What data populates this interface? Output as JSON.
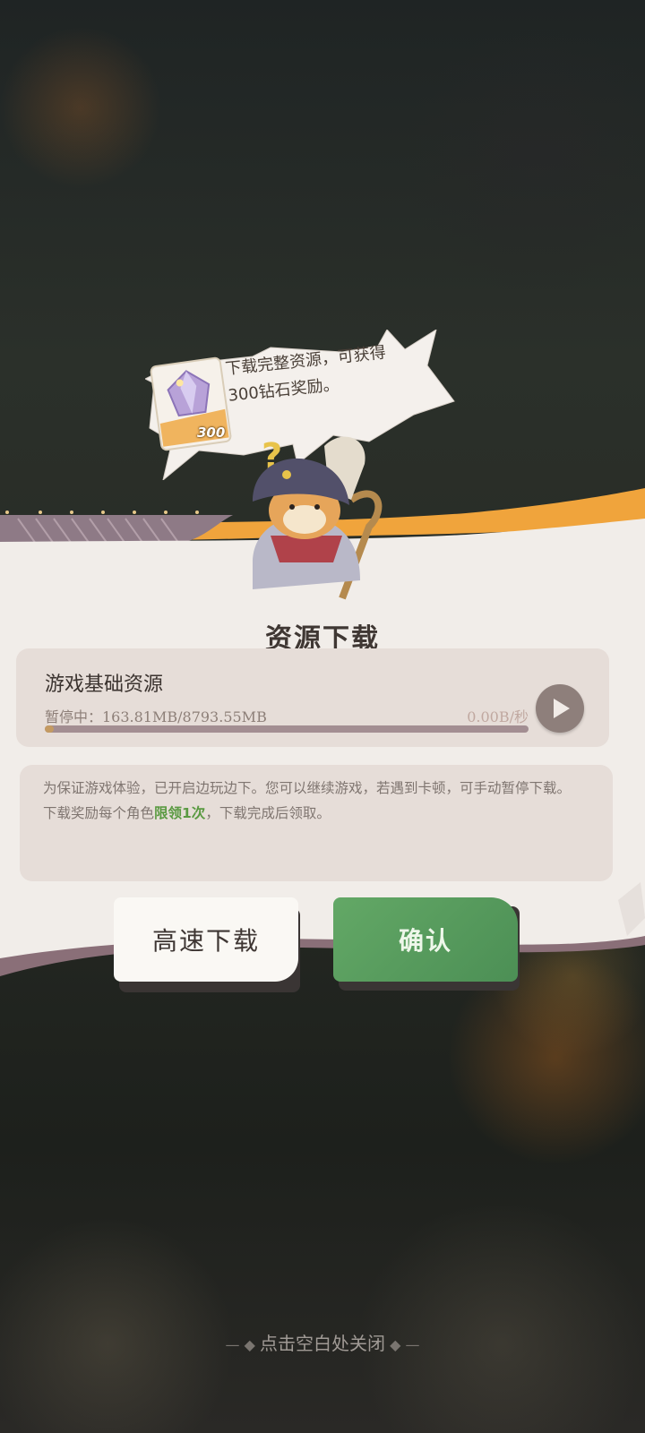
{
  "reward_bubble": {
    "text_line1": "下载完整资源，可获得",
    "text_line2": "300钻石奖励。",
    "diamond_count": "300",
    "icon": "diamond-icon"
  },
  "dialog": {
    "title": "资源下载",
    "resource": {
      "name": "游戏基础资源",
      "status": "暂停中：163.81MB/8793.55MB",
      "speed": "0.00B/秒",
      "progress_fraction": 0.0186,
      "play_icon": "play-icon"
    },
    "note": {
      "line1": "为保证游戏体验，已开启边玩边下。您可以继续游戏，若遇到卡顿，可手动暂停下载。",
      "line2_prefix": "下载奖励每个角色",
      "line2_highlight": "限领1次",
      "line2_suffix": "，下载完成后领取。"
    },
    "buttons": {
      "fast_download": "高速下载",
      "confirm": "确认"
    },
    "close_hint": "点击空白处关闭"
  },
  "colors": {
    "accent_orange": "#f0a43c",
    "confirm_green": "#5a9f5e",
    "highlight_green": "#5a9a42",
    "panel_bg": "#f1ede9"
  }
}
